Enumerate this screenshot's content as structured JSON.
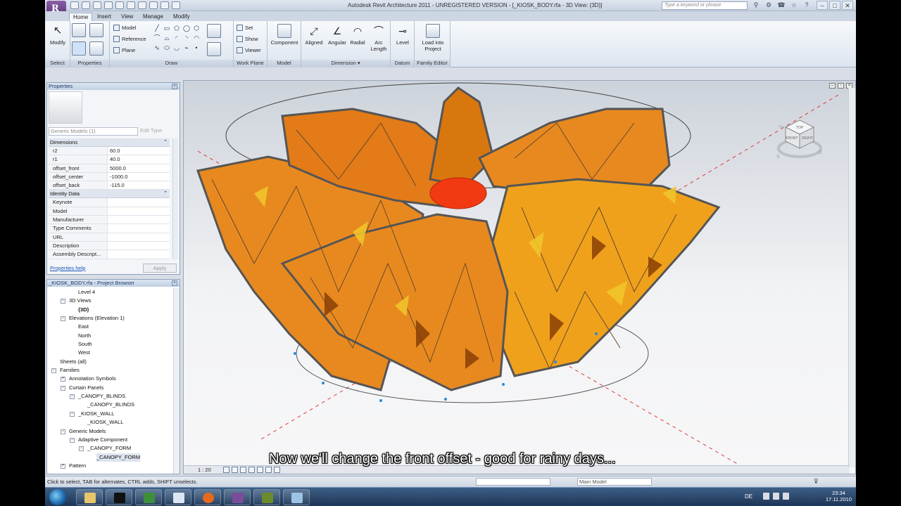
{
  "window": {
    "title": "Autodesk Revit Architecture 2011 - UNREGISTERED VERSION - [_KIOSK_BODY.rfa - 3D View: {3D}]",
    "search_placeholder": "Type a keyword or phrase",
    "app_letter": "R"
  },
  "tabs": [
    "Home",
    "Insert",
    "View",
    "Manage",
    "Modify"
  ],
  "ribbon": {
    "select": {
      "button": "Modify",
      "label": "Select"
    },
    "properties": {
      "label": "Properties"
    },
    "draw": {
      "label": "Draw",
      "model": "Model",
      "reference": "Reference",
      "plane": "Plane"
    },
    "work_plane": {
      "label": "Work Plane",
      "set": "Set",
      "show": "Show",
      "viewer": "Viewer"
    },
    "model": {
      "label": "Model",
      "component": "Component"
    },
    "dimension": {
      "label": "Dimension ▾",
      "aligned": "Aligned",
      "angular": "Angular",
      "radial": "Radial",
      "arc_length": "Arc Length"
    },
    "datum": {
      "label": "Datum",
      "level": "Level"
    },
    "family_editor": {
      "label": "Family Editor",
      "load": "Load into Project"
    }
  },
  "properties": {
    "header": "Properties",
    "type_selector": "Generic Models (1)",
    "edit_type": "Edit Type",
    "groups": [
      {
        "name": "Dimensions",
        "rows": [
          {
            "k": "r2",
            "v": "60.0"
          },
          {
            "k": "r1",
            "v": "40.0"
          },
          {
            "k": "offset_front",
            "v": "5000.0"
          },
          {
            "k": "offset_center",
            "v": "-1000.0"
          },
          {
            "k": "offset_back",
            "v": "-115.0"
          }
        ]
      },
      {
        "name": "Identity Data",
        "rows": [
          {
            "k": "Keynote",
            "v": ""
          },
          {
            "k": "Model",
            "v": ""
          },
          {
            "k": "Manufacturer",
            "v": ""
          },
          {
            "k": "Type Comments",
            "v": ""
          },
          {
            "k": "URL",
            "v": ""
          },
          {
            "k": "Description",
            "v": ""
          },
          {
            "k": "Assembly Descript...",
            "v": ""
          }
        ]
      }
    ],
    "help": "Properties help",
    "apply": "Apply"
  },
  "browser": {
    "header": "_KIOSK_BODY.rfa - Project Browser",
    "nodes": [
      {
        "label": "Level 4",
        "depth": 2,
        "toggle": ""
      },
      {
        "label": "3D Views",
        "depth": 1,
        "toggle": "−"
      },
      {
        "label": "{3D}",
        "depth": 2,
        "toggle": "",
        "bold": true
      },
      {
        "label": "Elevations (Elevation 1)",
        "depth": 1,
        "toggle": "−"
      },
      {
        "label": "East",
        "depth": 2,
        "toggle": ""
      },
      {
        "label": "North",
        "depth": 2,
        "toggle": ""
      },
      {
        "label": "South",
        "depth": 2,
        "toggle": ""
      },
      {
        "label": "West",
        "depth": 2,
        "toggle": ""
      },
      {
        "label": "Sheets (all)",
        "depth": 0,
        "toggle": ""
      },
      {
        "label": "Families",
        "depth": 0,
        "toggle": "−"
      },
      {
        "label": "Annotation Symbols",
        "depth": 1,
        "toggle": "+"
      },
      {
        "label": "Curtain Panels",
        "depth": 1,
        "toggle": "−"
      },
      {
        "label": "_CANOPY_BLINDS",
        "depth": 2,
        "toggle": "−"
      },
      {
        "label": "_CANOPY_BLINDS",
        "depth": 3,
        "toggle": ""
      },
      {
        "label": "_KIOSK_WALL",
        "depth": 2,
        "toggle": "−"
      },
      {
        "label": "_KIOSK_WALL",
        "depth": 3,
        "toggle": ""
      },
      {
        "label": "Generic Models",
        "depth": 1,
        "toggle": "−"
      },
      {
        "label": "Adaptive Component",
        "depth": 2,
        "toggle": "−"
      },
      {
        "label": "_CANOPY_FORM",
        "depth": 3,
        "toggle": "−"
      },
      {
        "label": "_CANOPY_FORM",
        "depth": 4,
        "toggle": "",
        "selected": true
      },
      {
        "label": "Pattern",
        "depth": 1,
        "toggle": "+"
      }
    ]
  },
  "viewport": {
    "scale": "1 : 20",
    "viewcube": {
      "top": "TOP",
      "front": "FRONT",
      "right": "RIGHT",
      "compass": [
        "N",
        "E",
        "S"
      ]
    }
  },
  "status": {
    "text": "Click to select, TAB for alternates, CTRL adds, SHIFT unselects.",
    "model": "Main Model"
  },
  "taskbar": {
    "lang": "DE",
    "time": "23:34",
    "date": "17.11.2010"
  },
  "subtitle": "Now we'll change the front offset - good for rainy days...",
  "colors": {
    "panel_orange": "#e8891f",
    "panel_yellow": "#f0b21a",
    "panel_dark": "#9a4c07",
    "frame_grey": "#5c5c5c",
    "sphere_red": "#f23a12"
  }
}
